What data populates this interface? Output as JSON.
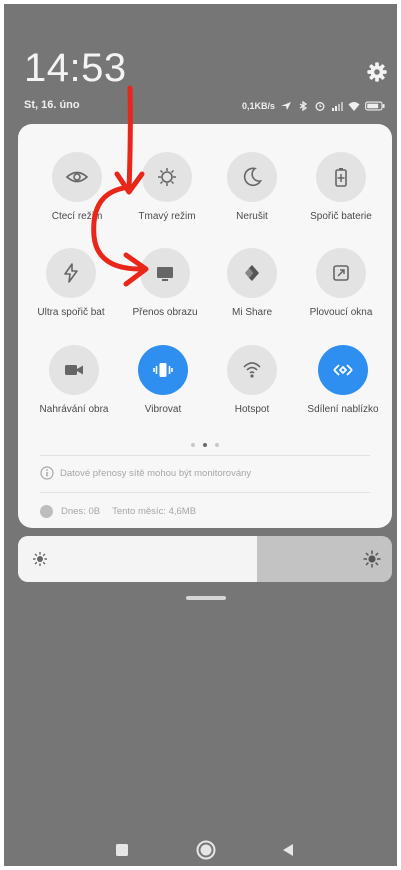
{
  "status": {
    "time": "14:53",
    "date": "St, 16. úno",
    "net_speed": "0,1KB/s"
  },
  "tiles": [
    {
      "label": "Čtecí režim",
      "icon": "eye-icon",
      "active": false
    },
    {
      "label": "Tmavý režim",
      "icon": "dark-mode-icon",
      "active": false
    },
    {
      "label": "Nerušit",
      "icon": "moon-icon",
      "active": false
    },
    {
      "label": "Spořič baterie",
      "icon": "battery-saver-icon",
      "active": false
    },
    {
      "label": "Ultra spořič bat",
      "icon": "lightning-icon",
      "active": false
    },
    {
      "label": "Přenos obrazu",
      "icon": "cast-screen-icon",
      "active": false
    },
    {
      "label": "Mi Share",
      "icon": "mi-share-icon",
      "active": false
    },
    {
      "label": "Plovoucí okna",
      "icon": "floating-window-icon",
      "active": false
    },
    {
      "label": "Nahrávání obra",
      "icon": "video-camera-icon",
      "active": false
    },
    {
      "label": "Vibrovat",
      "icon": "vibrate-icon",
      "active": true
    },
    {
      "label": "Hotspot",
      "icon": "hotspot-icon",
      "active": false
    },
    {
      "label": "Sdílení nablízko",
      "icon": "nearby-share-icon",
      "active": true
    }
  ],
  "page_indicator": {
    "count": 3,
    "active_index": 1
  },
  "notice": "Datové přenosy sítě mohou být monitorovány",
  "data_usage": {
    "today": "Dnes: 0B",
    "month": "Tento měsíc: 4,6MB"
  },
  "brightness": {
    "level": 0.64
  },
  "colors": {
    "background": "#767676",
    "panel": "#f7f7f7",
    "accent": "#2f8ff0",
    "annotation": "#e8261a"
  }
}
